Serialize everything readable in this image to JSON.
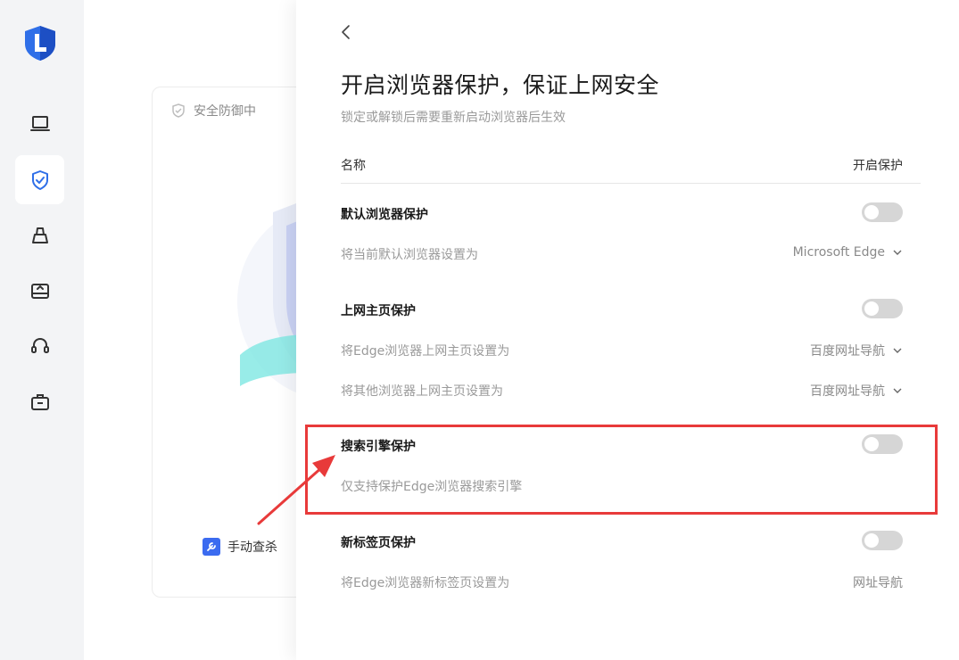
{
  "colors": {
    "accent": "#3b6bf0",
    "highlight": "#e83a3a",
    "toggle_off": "#d6d6d6"
  },
  "nav": {
    "items": [
      {
        "icon": "laptop-icon"
      },
      {
        "icon": "shield-check-icon",
        "active": true
      },
      {
        "icon": "broom-icon"
      },
      {
        "icon": "drive-upload-icon"
      },
      {
        "icon": "headset-icon"
      },
      {
        "icon": "toolbox-icon"
      }
    ]
  },
  "background": {
    "status_text": "安全防御中",
    "manual_scan_label": "手动查杀"
  },
  "panel": {
    "title": "开启浏览器保护，保证上网安全",
    "subtitle": "锁定或解锁后需要重新启动浏览器后生效",
    "header_name": "名称",
    "header_enable": "开启保护",
    "sections": [
      {
        "title": "默认浏览器保护",
        "enabled": false,
        "rows": [
          {
            "label": "将当前默认浏览器设置为",
            "value": "Microsoft Edge",
            "dropdown": true
          }
        ]
      },
      {
        "title": "上网主页保护",
        "enabled": false,
        "rows": [
          {
            "label": "将Edge浏览器上网主页设置为",
            "value": "百度网址导航",
            "dropdown": true
          },
          {
            "label": "将其他浏览器上网主页设置为",
            "value": "百度网址导航",
            "dropdown": true
          }
        ]
      },
      {
        "title": "搜索引擎保护",
        "enabled": false,
        "rows": [
          {
            "label": "仅支持保护Edge浏览器搜索引擎",
            "value": "",
            "dropdown": false
          }
        ]
      },
      {
        "title": "新标签页保护",
        "enabled": false,
        "rows": [
          {
            "label": "将Edge浏览器新标签页设置为",
            "value": "网址导航",
            "dropdown": false
          }
        ]
      }
    ]
  }
}
